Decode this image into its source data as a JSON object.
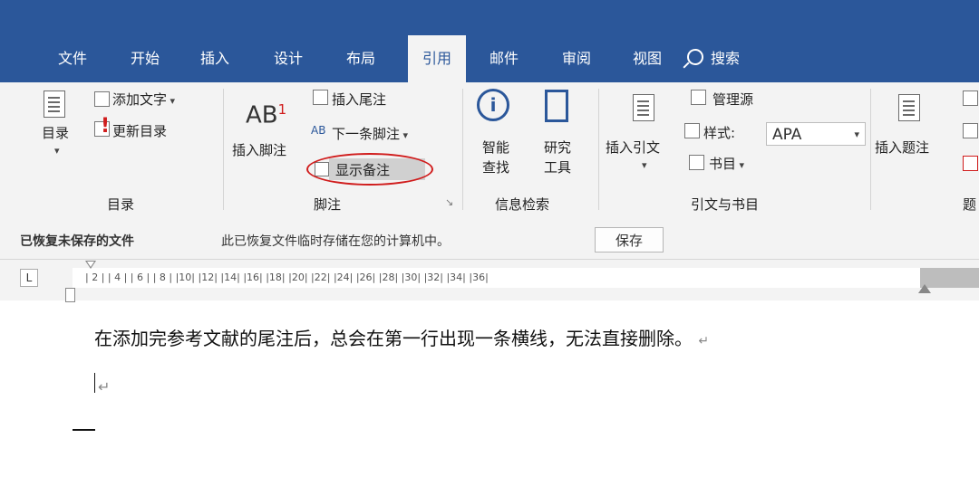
{
  "tabs": [
    {
      "label": "文件",
      "active": false
    },
    {
      "label": "开始",
      "active": false
    },
    {
      "label": "插入",
      "active": false
    },
    {
      "label": "设计",
      "active": false
    },
    {
      "label": "布局",
      "active": false
    },
    {
      "label": "引用",
      "active": true
    },
    {
      "label": "邮件",
      "active": false
    },
    {
      "label": "审阅",
      "active": false
    },
    {
      "label": "视图",
      "active": false
    }
  ],
  "search": {
    "label": "搜索",
    "icon": "search-icon"
  },
  "ribbon": {
    "toc": {
      "big_button": "目录",
      "add_text": "添加文字",
      "update_toc": "更新目录",
      "group_label": "目录"
    },
    "footnotes": {
      "insert_footnote_icon_text": "AB",
      "insert_footnote_sup": "1",
      "insert_footnote": "插入脚注",
      "insert_endnote": "插入尾注",
      "next_footnote": "下一条脚注",
      "show_notes": "显示备注",
      "group_label": "脚注"
    },
    "research": {
      "smart_lookup_1": "智能",
      "smart_lookup_2": "查找",
      "researcher_1": "研究",
      "researcher_2": "工具",
      "group_label": "信息检索"
    },
    "citations": {
      "insert_citation": "插入引文",
      "manage_sources": "管理源",
      "style_label": "样式:",
      "style_value": "APA",
      "bibliography": "书目",
      "group_label": "引文与书目"
    },
    "captions": {
      "insert_caption": "插入题注",
      "group_label": "题"
    }
  },
  "infobar": {
    "title": "已恢复未保存的文件",
    "message": "此已恢复文件临时存储在您的计算机中。",
    "save_button": "保存"
  },
  "ruler": {
    "tab_selector": "L",
    "marks": "| 2 |   | 4 |   | 6 |   | 8 |   |10|   |12|   |14|   |16|   |18|   |20|   |22|   |24|   |26|   |28|   |30|   |32|   |34|   |36|"
  },
  "document": {
    "paragraph": "在添加完参考文献的尾注后，总会在第一行出现一条横线，无法直接删除。",
    "para_mark": "↵"
  },
  "colors": {
    "tab_bar": "#2b579a",
    "ribbon": "#f3f3f3",
    "highlight": "#d01c1c"
  }
}
